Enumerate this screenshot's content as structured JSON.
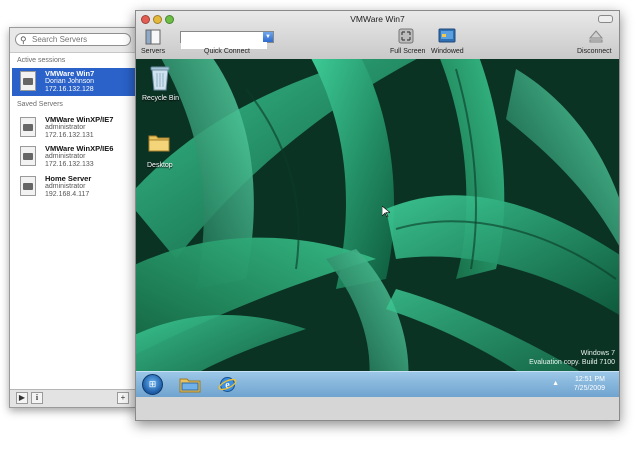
{
  "sidebar": {
    "search_placeholder": "Search Servers",
    "active_title": "Active sessions",
    "saved_title": "Saved Servers",
    "active": [
      {
        "name": "VMWare Win7",
        "user": "Dorian Johnson",
        "ip": "172.16.132.128"
      }
    ],
    "saved": [
      {
        "name": "VMWare WinXP/IE7",
        "user": "administrator",
        "ip": "172.16.132.131"
      },
      {
        "name": "VMWare WinXP/IE6",
        "user": "administrator",
        "ip": "172.16.132.133"
      },
      {
        "name": "Home Server",
        "user": "administrator",
        "ip": "192.168.4.117"
      }
    ],
    "bottom": {
      "play": "▶",
      "info": "i",
      "add": "+"
    }
  },
  "window": {
    "title": "VMWare Win7",
    "toolbar": {
      "servers": "Servers",
      "quick_connect": "Quick Connect",
      "quick_connect_value": "",
      "full_screen": "Full Screen",
      "windowed": "Windowed",
      "disconnect": "Disconnect"
    }
  },
  "desktop": {
    "icons": [
      {
        "label": "Recycle Bin"
      },
      {
        "label": "Desktop"
      }
    ],
    "watermark_line1": "Windows 7",
    "watermark_line2": "Evaluation copy. Build 7100",
    "clock_time": "12:51 PM",
    "clock_date": "7/25/2009"
  },
  "colors": {
    "selection": "#2a62c9",
    "taskbar": "#8bb9de"
  }
}
